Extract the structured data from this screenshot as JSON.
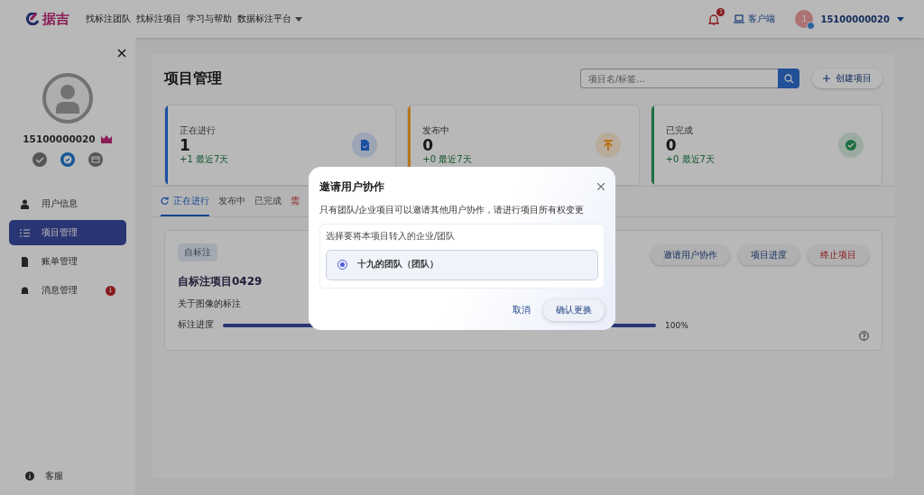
{
  "topbar": {
    "logo": "据吉",
    "links": [
      {
        "label": "找标注团队",
        "dropdown": false
      },
      {
        "label": "找标注项目",
        "dropdown": false
      },
      {
        "label": "学习与帮助",
        "dropdown": false
      },
      {
        "label": "数据标注平台",
        "dropdown": true
      }
    ],
    "notification_count": "1",
    "client": "客户端",
    "avatar": "1",
    "user": "15100000020"
  },
  "sidebar": {
    "username": "15100000020",
    "menu": [
      {
        "label": "用户信息",
        "selected": false
      },
      {
        "label": "项目管理",
        "selected": true
      },
      {
        "label": "账单管理",
        "selected": false
      },
      {
        "label": "消息管理",
        "selected": false,
        "badge": "1"
      }
    ],
    "support": "客服"
  },
  "main": {
    "title": "项目管理",
    "search": {
      "placeholder": "项目名/标签..."
    },
    "create_button": "创建项目",
    "stats": [
      {
        "label": "正在进行",
        "value": "1",
        "delta": "+1 最近7天",
        "color": "#1b4fa0"
      },
      {
        "label": "发布中",
        "value": "0",
        "delta": "+0 最近7天",
        "color": "#b8741a"
      },
      {
        "label": "已完成",
        "value": "0",
        "delta": "+0 最近7天",
        "color": "#1d7040"
      }
    ],
    "tabs": [
      {
        "label": "正在进行",
        "selected": true,
        "kind": "normal"
      },
      {
        "label": "发布中",
        "selected": false,
        "kind": "normal"
      },
      {
        "label": "已完成",
        "selected": false,
        "kind": "normal"
      },
      {
        "label": "需",
        "selected": false,
        "kind": "alert"
      }
    ],
    "project": {
      "tag": "自标注",
      "title": "自标注项目0429",
      "description": "关于图像的标注",
      "progress_label": "标注进度",
      "level": 1,
      "progress_text": "100%",
      "buttons": [
        {
          "label": "邀请用户协作",
          "kind": "normal"
        },
        {
          "label": "项目进度",
          "kind": "normal"
        },
        {
          "label": "终止项目",
          "kind": "danger"
        }
      ]
    }
  },
  "dialog": {
    "title": "邀请用户协作",
    "note": "只有团队/企业项目可以邀请其他用户协作，请进行项目所有权变更",
    "section_label": "选择要将本项目转入的企业/团队",
    "options": [
      {
        "label": "十九的团队（团队）",
        "selected": true
      }
    ],
    "cancel": "取消",
    "confirm": "确认更换"
  }
}
